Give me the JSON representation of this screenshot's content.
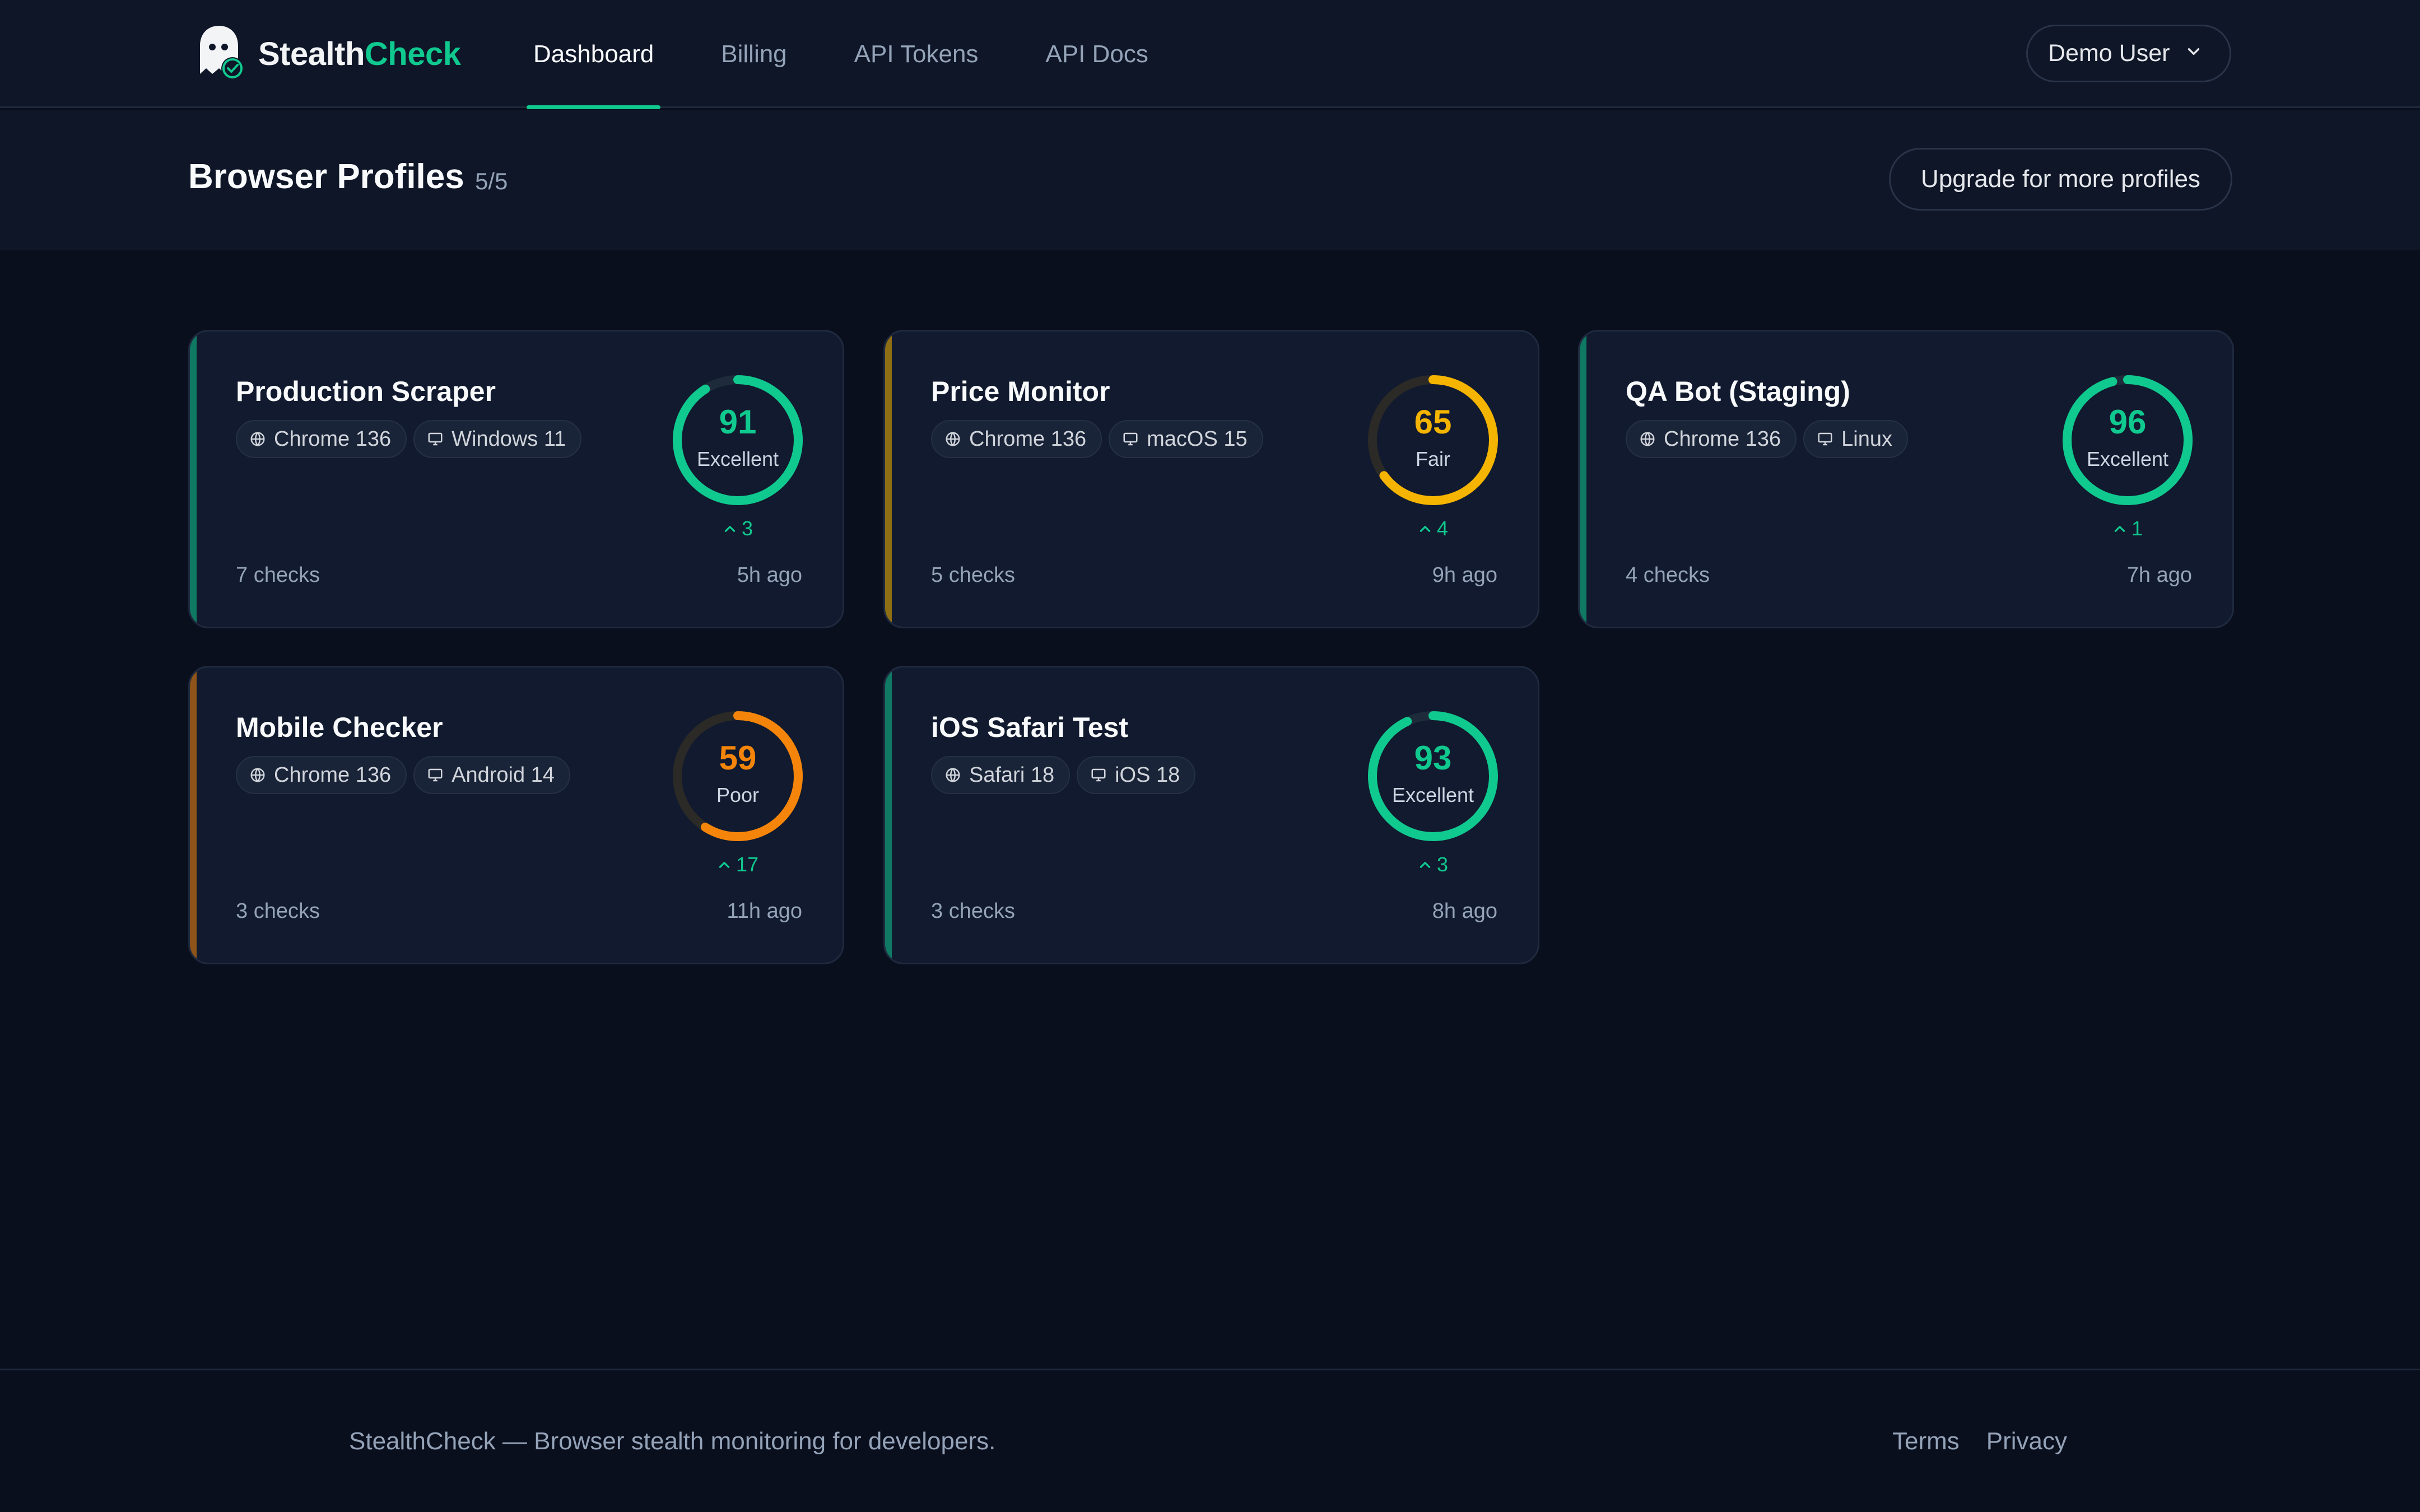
{
  "app": {
    "brand_part1": "Stealth",
    "brand_part2": "Check"
  },
  "nav": {
    "items": [
      {
        "label": "Dashboard",
        "active": true
      },
      {
        "label": "Billing",
        "active": false
      },
      {
        "label": "API Tokens",
        "active": false
      },
      {
        "label": "API Docs",
        "active": false
      }
    ]
  },
  "user": {
    "name": "Demo User"
  },
  "page": {
    "title": "Browser Profiles",
    "count": "5/5",
    "upgrade_label": "Upgrade for more profiles"
  },
  "profiles": [
    {
      "name": "Production Scraper",
      "browser": "Chrome 136",
      "os": "Windows 11",
      "score": "91",
      "score_value": 91,
      "grade": "Excellent",
      "delta": "3",
      "checks": "7 checks",
      "ago": "5h ago",
      "color": "#10c98f"
    },
    {
      "name": "Price Monitor",
      "browser": "Chrome 136",
      "os": "macOS 15",
      "score": "65",
      "score_value": 65,
      "grade": "Fair",
      "delta": "4",
      "checks": "5 checks",
      "ago": "9h ago",
      "color": "#f5b400"
    },
    {
      "name": "QA Bot (Staging)",
      "browser": "Chrome 136",
      "os": "Linux",
      "score": "96",
      "score_value": 96,
      "grade": "Excellent",
      "delta": "1",
      "checks": "4 checks",
      "ago": "7h ago",
      "color": "#10c98f"
    },
    {
      "name": "Mobile Checker",
      "browser": "Chrome 136",
      "os": "Android 14",
      "score": "59",
      "score_value": 59,
      "grade": "Poor",
      "delta": "17",
      "checks": "3 checks",
      "ago": "11h ago",
      "color": "#f5850a"
    },
    {
      "name": "iOS Safari Test",
      "browser": "Safari 18",
      "os": "iOS 18",
      "score": "93",
      "score_value": 93,
      "grade": "Excellent",
      "delta": "3",
      "checks": "3 checks",
      "ago": "8h ago",
      "color": "#10c98f"
    }
  ],
  "icons": {
    "browser": "globe-icon",
    "os": "monitor-icon",
    "delta": "chevron-up-icon",
    "user_menu": "chevron-down-icon",
    "logo": "ghost-check-logo"
  },
  "footer": {
    "text": "StealthCheck — Browser stealth monitoring for developers.",
    "terms": "Terms",
    "privacy": "Privacy"
  }
}
